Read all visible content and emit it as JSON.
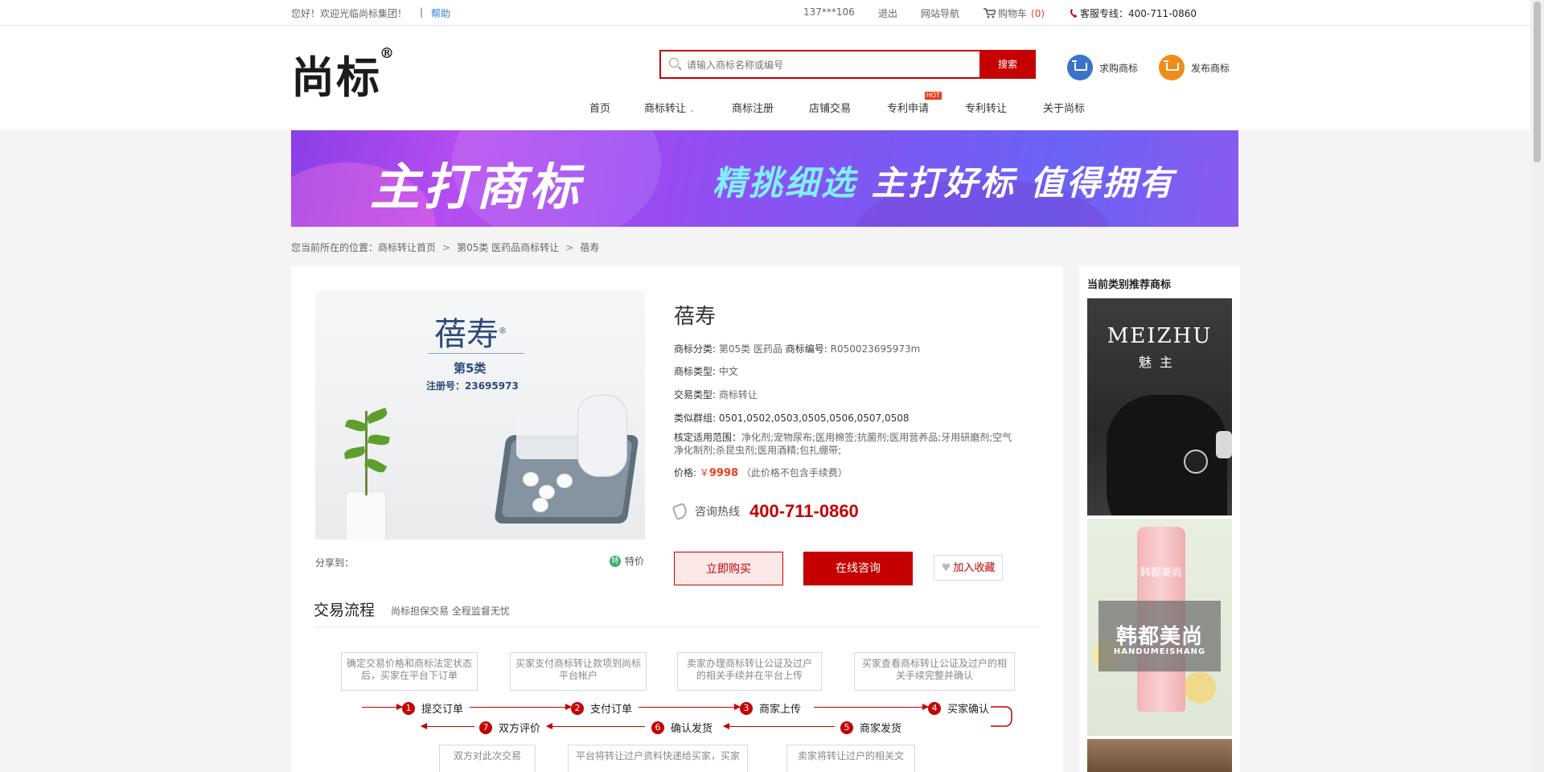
{
  "topbar": {
    "welcome": "您好！欢迎光临尚标集团！",
    "divider": "|",
    "help": "帮助",
    "account": "137***106",
    "logout": "退出",
    "site_nav": "网站导航",
    "cart_label": "购物车",
    "cart_count": "(0)",
    "hotline": "客服专线：400-711-0860"
  },
  "header": {
    "logo_text": "尚标",
    "logo_reg": "®",
    "search_placeholder": "请输入商标名称或编号",
    "search_button": "搜索",
    "buy_trademark": "求购商标",
    "publish_trademark": "发布商标"
  },
  "nav": {
    "items": [
      "首页",
      "商标转让",
      "商标注册",
      "店铺交易",
      "专利申请",
      "专利转让",
      "关于尚标"
    ],
    "hot_badge": "HOT"
  },
  "banner": {
    "title": "主打商标",
    "slogan_a": "精挑细选",
    "slogan_b": "主打好标",
    "slogan_c": "值得拥有"
  },
  "breadcrumb": {
    "prefix": "您当前所在的位置：",
    "level1": "商标转让首页",
    "level2": "第05类 医药品商标转让",
    "level3": "蓓寿",
    "sep": ">"
  },
  "product": {
    "image": {
      "name": "蓓寿",
      "reg_mark": "®",
      "class": "第5类",
      "reg_no": "注册号：23695973"
    },
    "name": "蓓寿",
    "category_label": "商标分类:",
    "category_value": "第05类 医药品",
    "number_label": "商标编号:",
    "number_value": "R050023695973m",
    "type_label": "商标类型:",
    "type_value": "中文",
    "trade_label": "交易类型:",
    "trade_value": "商标转让",
    "group_label": "类似群组:",
    "group_value": "0501,0502,0503,0505,0506,0507,0508",
    "scope_label": "核定适用范围：",
    "scope_value": "净化剂;宠物尿布;医用棉签;抗菌剂;医用营养品;牙用研磨剂;空气净化制剂;杀昆虫剂;医用酒精;包扎绷带;",
    "price_label": "价格:",
    "price_currency": "￥",
    "price_value": "9998",
    "price_note": "（此价格不包含手续费）",
    "consult_label": "咨询热线",
    "consult_number": "400-711-0860",
    "buy_button": "立即购买",
    "chat_button": "在线咨询",
    "fav_button": "加入收藏",
    "share_label": "分享到：",
    "special_badge": "特",
    "special_label": "特价"
  },
  "flow": {
    "title": "交易流程",
    "subtitle": "尚标担保交易 全程监督无忧",
    "notes_top": [
      "确定交易价格和商标法定状态后，买家在平台下订单",
      "买家支付商标转让款项到尚标平台帐户",
      "卖家办理商标转让公证及过户的相关手续并在平台上传",
      "买家查看商标转让公证及过户的相关手续完整并确认"
    ],
    "notes_bottom": [
      "双方对此次交易",
      "平台将转让过户资料快递给买家，买家",
      "卖家将转让过户的相关文"
    ],
    "steps": [
      {
        "n": "1",
        "label": "提交订单"
      },
      {
        "n": "2",
        "label": "支付订单"
      },
      {
        "n": "3",
        "label": "商家上传"
      },
      {
        "n": "4",
        "label": "买家确认"
      },
      {
        "n": "5",
        "label": "商家发货"
      },
      {
        "n": "6",
        "label": "确认发货"
      },
      {
        "n": "7",
        "label": "双方评价"
      }
    ]
  },
  "sidebar": {
    "title": "当前类别推荐商标",
    "rec1_brand": "MEIZHU",
    "rec1_brand_cn": "魅主",
    "rec2_tube": "韩都美尚",
    "rec2_brand": "韩都美尚",
    "rec2_brand_en": "HANDUMEISHANG"
  },
  "colors": {
    "brand_red": "#c40000",
    "price_orange": "#e8401a",
    "link_blue": "#2f7fd0"
  }
}
